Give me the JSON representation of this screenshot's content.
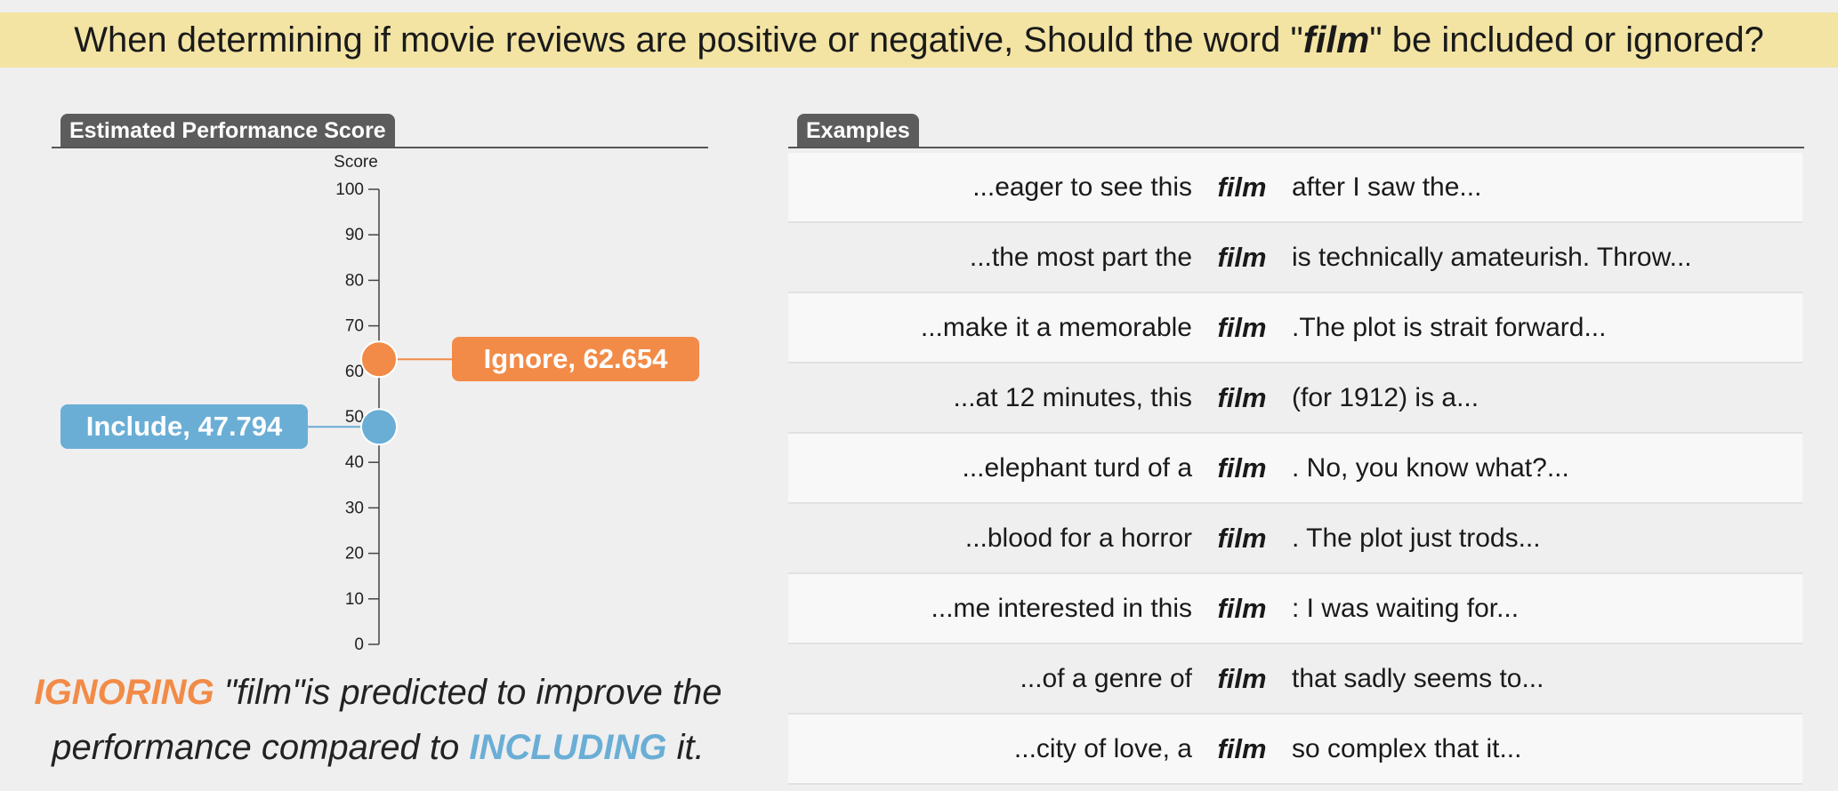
{
  "banner": {
    "prefix": "When determining if movie reviews are positive or negative, Should the word \"",
    "keyword": "film",
    "suffix": "\" be included or ignored?"
  },
  "score_panel": {
    "tab_label": "Estimated Performance Score"
  },
  "examples_panel": {
    "tab_label": "Examples"
  },
  "colors": {
    "ignore": "#f28b47",
    "include": "#6aaed6",
    "banner_bg": "#f3e4a4",
    "tab_bg": "#5c5c5c"
  },
  "chart_data": {
    "type": "scatter",
    "ylabel": "Score",
    "ylim": [
      0,
      100
    ],
    "yticks": [
      0,
      10,
      20,
      30,
      40,
      50,
      60,
      70,
      80,
      90,
      100
    ],
    "points": [
      {
        "name": "Ignore",
        "value": 62.654,
        "label": "Ignore, 62.654",
        "color": "#f28b47",
        "label_side": "right"
      },
      {
        "name": "Include",
        "value": 47.794,
        "label": "Include, 47.794",
        "color": "#6aaed6",
        "label_side": "left"
      }
    ]
  },
  "conclusion": {
    "ignore_word": "IGNORING",
    "part1": " \"film\"is predicted to improve the",
    "part2": "performance compared to ",
    "include_word": "INCLUDING",
    "part3": " it."
  },
  "examples": [
    {
      "left": "...eager to see this",
      "word": "film",
      "right": "after I saw the..."
    },
    {
      "left": "...the most part the",
      "word": "film",
      "right": "is technically amateurish. Throw..."
    },
    {
      "left": "...make it a memorable",
      "word": "film",
      "right": ".The plot is strait forward..."
    },
    {
      "left": "...at 12 minutes, this",
      "word": "film",
      "right": "(for 1912) is a..."
    },
    {
      "left": "...elephant turd of a",
      "word": "film",
      "right": ". No, you know what?..."
    },
    {
      "left": "...blood for a horror",
      "word": "film",
      "right": ". The plot just trods..."
    },
    {
      "left": "...me interested in this",
      "word": "film",
      "right": ": I was waiting for..."
    },
    {
      "left": "...of a genre of",
      "word": "film",
      "right": "that sadly seems to..."
    },
    {
      "left": "...city of love, a",
      "word": "film",
      "right": "so complex that it..."
    }
  ]
}
